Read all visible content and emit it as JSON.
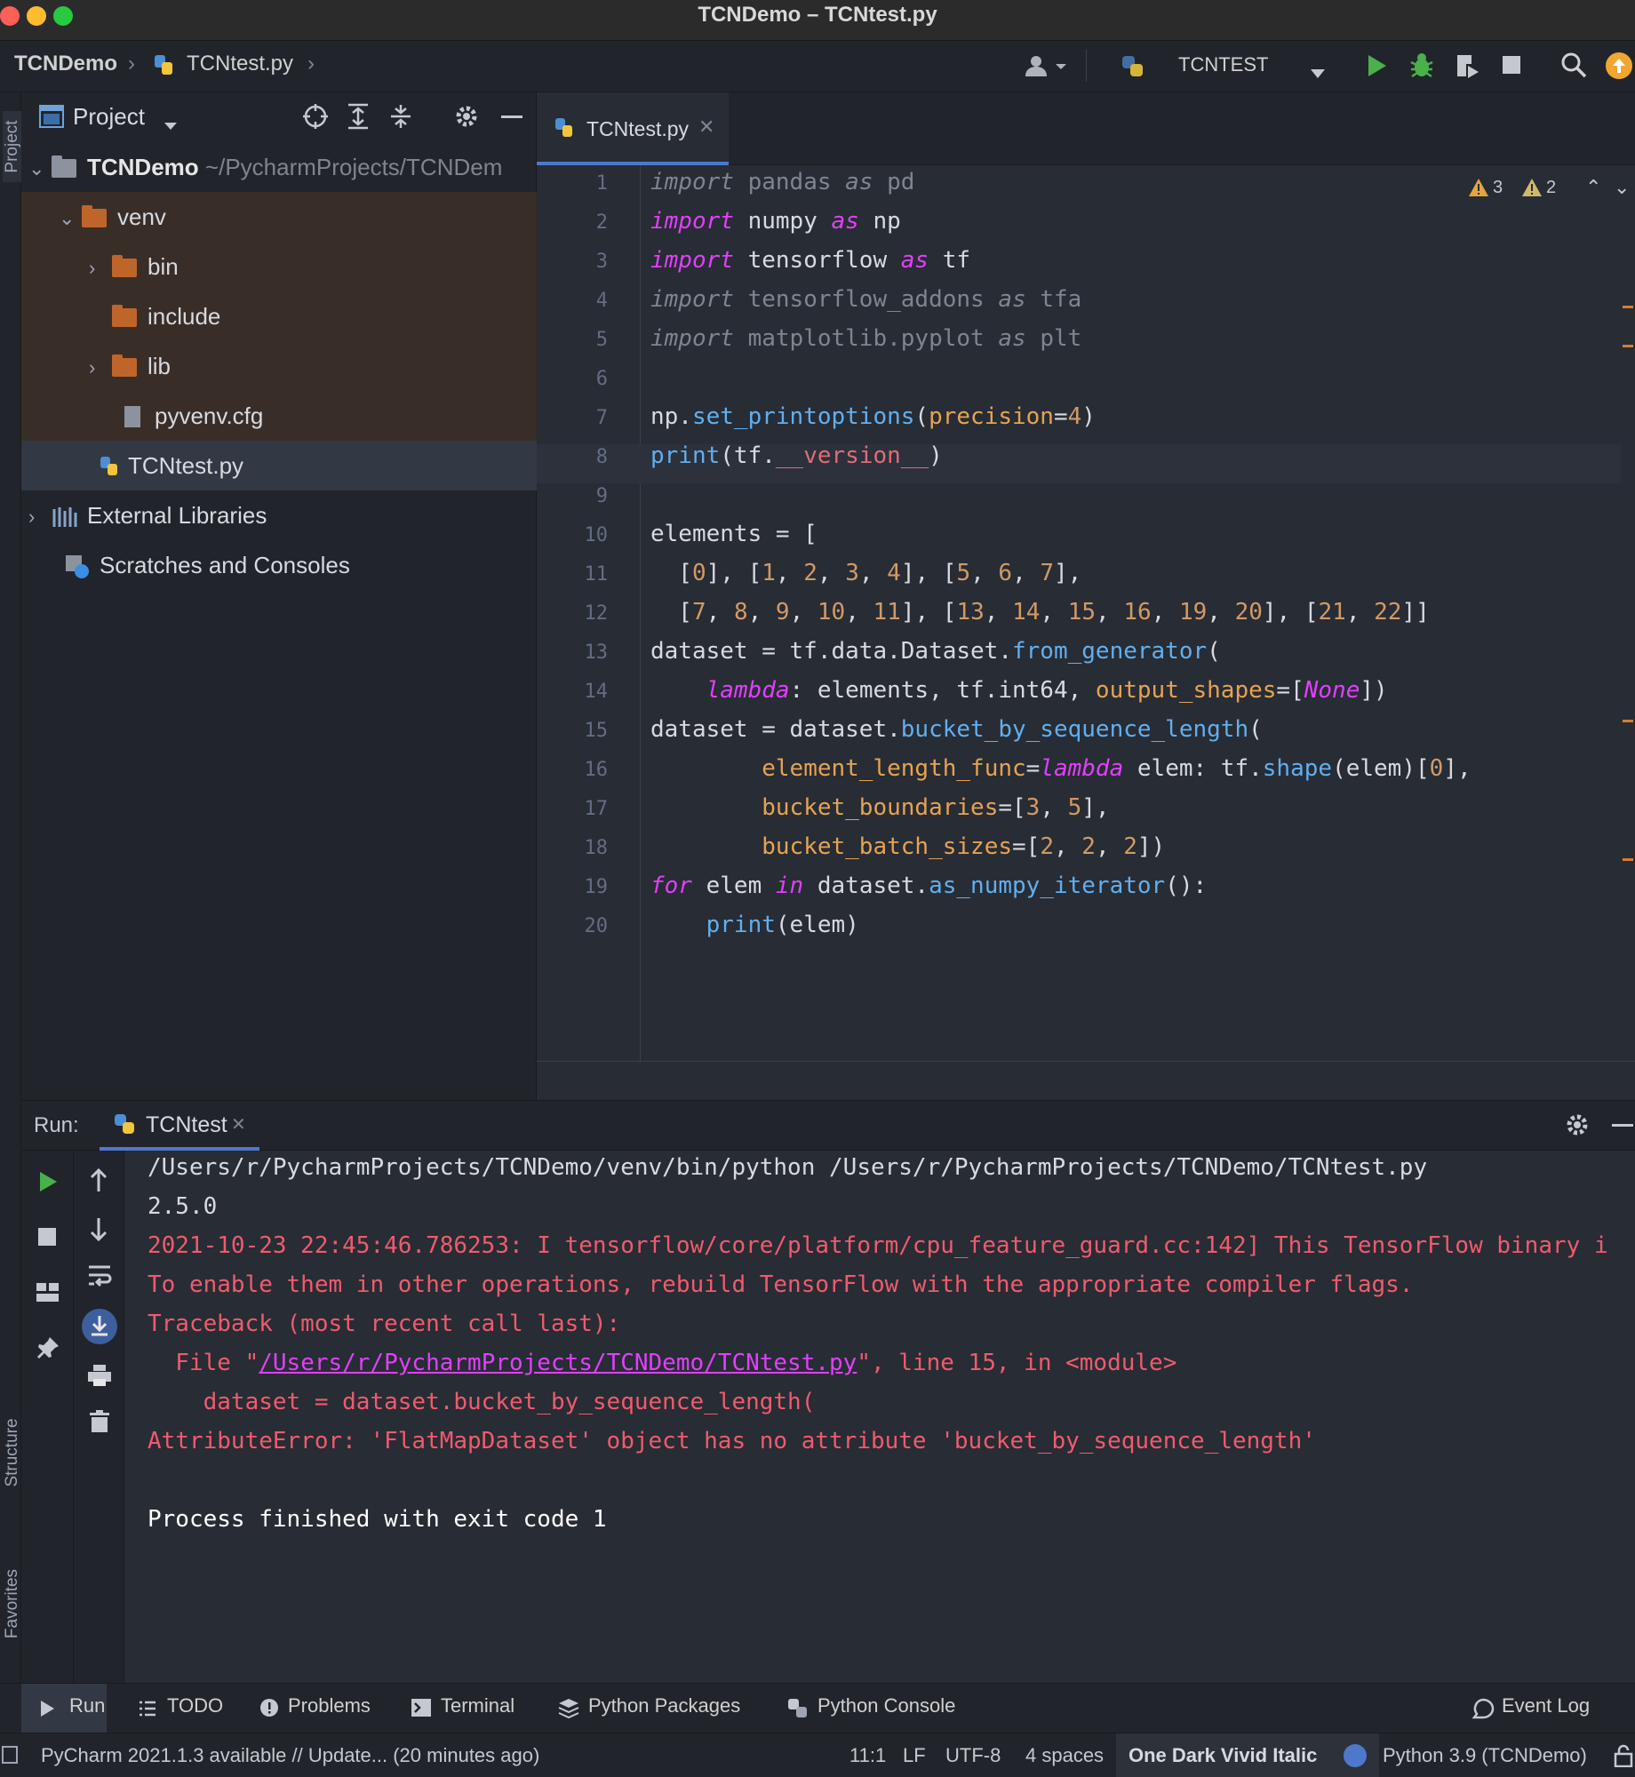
{
  "window": {
    "title": "TCNDemo – TCNtest.py"
  },
  "nav": {
    "project": "TCNDemo",
    "file": "TCNtest.py",
    "run_config": "TCNTEST"
  },
  "sidebar_stripe": {
    "project": "Project",
    "structure": "Structure",
    "favorites": "Favorites"
  },
  "project_panel": {
    "title": "Project",
    "root": {
      "name": "TCNDemo",
      "path": "~/PycharmProjects/TCNDem"
    },
    "items": [
      {
        "label": "venv"
      },
      {
        "label": "bin"
      },
      {
        "label": "include"
      },
      {
        "label": "lib"
      },
      {
        "label": "pyvenv.cfg"
      },
      {
        "label": "TCNtest.py"
      },
      {
        "label": "External Libraries"
      },
      {
        "label": "Scratches and Consoles"
      }
    ]
  },
  "editor": {
    "tab": "TCNtest.py",
    "warnings_a": "3",
    "warnings_b": "2",
    "line_numbers": [
      "1",
      "2",
      "3",
      "4",
      "5",
      "6",
      "7",
      "8",
      "9",
      "10",
      "11",
      "12",
      "13",
      "14",
      "15",
      "16",
      "17",
      "18",
      "19",
      "20"
    ],
    "lines": [
      "import pandas as pd",
      "import numpy as np",
      "import tensorflow as tf",
      "import tensorflow_addons as tfa",
      "import matplotlib.pyplot as plt",
      "",
      "np.set_printoptions(precision=4)",
      "print(tf.__version__)",
      "",
      "elements = [",
      "  [0], [1, 2, 3, 4], [5, 6, 7],",
      "  [7, 8, 9, 10, 11], [13, 14, 15, 16, 19, 20], [21, 22]]",
      "dataset = tf.data.Dataset.from_generator(",
      "    lambda: elements, tf.int64, output_shapes=[None])",
      "dataset = dataset.bucket_by_sequence_length(",
      "        element_length_func=lambda elem: tf.shape(elem)[0],",
      "        bucket_boundaries=[3, 5],",
      "        bucket_batch_sizes=[2, 2, 2])",
      "for elem in dataset.as_numpy_iterator():",
      "    print(elem)"
    ]
  },
  "run_panel": {
    "label": "Run:",
    "tab": "TCNtest",
    "output": [
      "/Users/r/PycharmProjects/TCNDemo/venv/bin/python /Users/r/PycharmProjects/TCNDemo/TCNtest.py",
      "2.5.0",
      "2021-10-23 22:45:46.786253: I tensorflow/core/platform/cpu_feature_guard.cc:142] This TensorFlow binary i",
      "To enable them in other operations, rebuild TensorFlow with the appropriate compiler flags.",
      "Traceback (most recent call last):",
      "  File \"",
      "/Users/r/PycharmProjects/TCNDemo/TCNtest.py",
      "\", line 15, in <module>",
      "    dataset = dataset.bucket_by_sequence_length(",
      "AttributeError: 'FlatMapDataset' object has no attribute 'bucket_by_sequence_length'",
      "",
      "Process finished with exit code 1"
    ]
  },
  "bottom_tools": {
    "run": "Run",
    "todo": "TODO",
    "problems": "Problems",
    "terminal": "Terminal",
    "packages": "Python Packages",
    "console": "Python Console",
    "event_log": "Event Log"
  },
  "status": {
    "update": "PyCharm 2021.1.3 available // Update... (20 minutes ago)",
    "position": "11:1",
    "line_sep": "LF",
    "encoding": "UTF-8",
    "indent": "4 spaces",
    "theme": "One Dark Vivid Italic",
    "interpreter": "Python 3.9 (TCNDemo)"
  },
  "colors": {
    "accent": "#4d78cc",
    "error": "#ef5b6d",
    "keyword": "#e040fb",
    "function": "#61afef",
    "number": "#d19a66"
  }
}
